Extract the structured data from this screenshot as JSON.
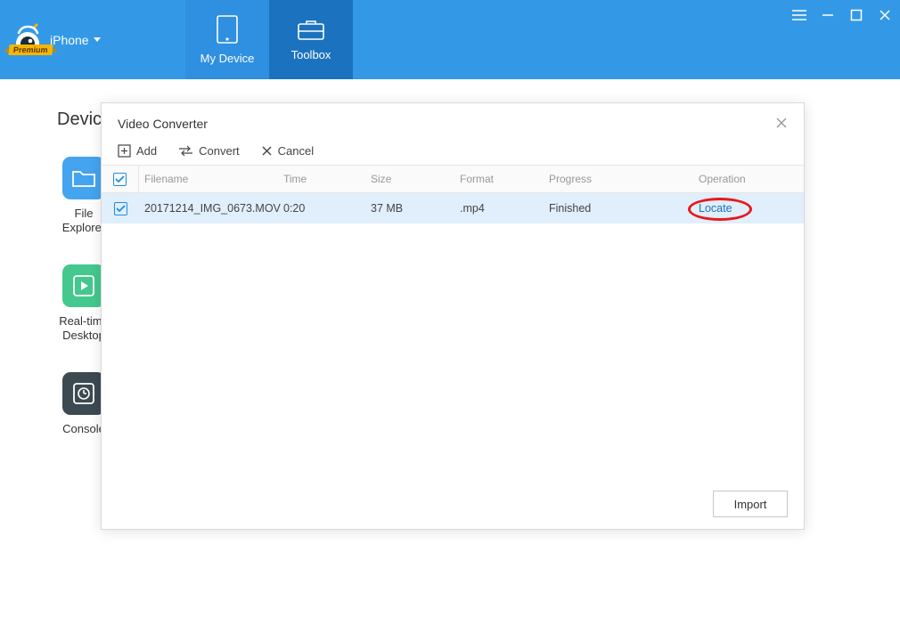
{
  "header": {
    "device_label": "iPhone",
    "premium_badge": "Premium",
    "tabs": {
      "my_device": "My Device",
      "toolbox": "Toolbox"
    }
  },
  "page": {
    "title": "Devic"
  },
  "tools": {
    "file_explorer": "File\nExplorer",
    "realtime_desktop": "Real-time\nDesktop",
    "console": "Console"
  },
  "dialog": {
    "title": "Video Converter",
    "toolbar": {
      "add": "Add",
      "convert": "Convert",
      "cancel": "Cancel"
    },
    "columns": {
      "filename": "Filename",
      "time": "Time",
      "size": "Size",
      "format": "Format",
      "progress": "Progress",
      "operation": "Operation"
    },
    "rows": [
      {
        "filename": "20171214_IMG_0673.MOV",
        "time": "0:20",
        "size": "37 MB",
        "format": ".mp4",
        "progress": "Finished",
        "operation": "Locate"
      }
    ],
    "footer": {
      "import": "Import"
    }
  }
}
